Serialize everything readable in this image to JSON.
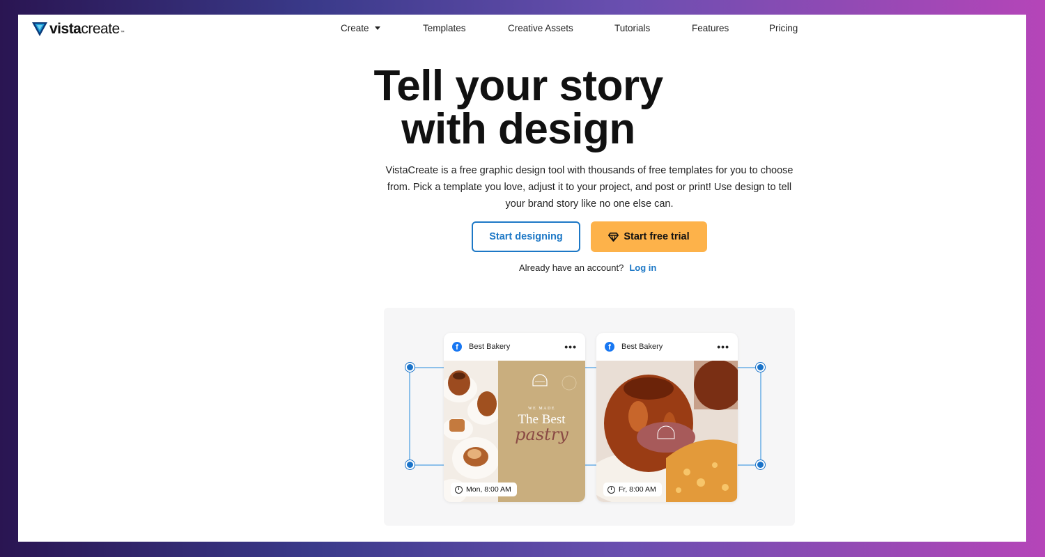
{
  "brand": {
    "logo_bold": "vista",
    "logo_light": "create",
    "tm": "™"
  },
  "nav": {
    "items": [
      {
        "label": "Create",
        "has_caret": true
      },
      {
        "label": "Templates"
      },
      {
        "label": "Creative Assets"
      },
      {
        "label": "Tutorials"
      },
      {
        "label": "Features"
      },
      {
        "label": "Pricing"
      }
    ]
  },
  "hero": {
    "title_line1": "Tell your story",
    "title_line2": "with design",
    "subtitle": "VistaCreate is a free graphic design tool with thousands of free templates for you to choose from. Pick a template you love, adjust it to your project, and post or print! Use design to tell your brand story like no one else can.",
    "primary_button": "Start designing",
    "trial_button": "Start free trial",
    "account_prompt": "Already have an account?",
    "login_link": "Log in"
  },
  "preview": {
    "cards": [
      {
        "page_name": "Best Bakery",
        "time": "Mon, 8:00 AM",
        "overlay_small": "WE MADE",
        "overlay_title": "The Best",
        "overlay_script": "pastry"
      },
      {
        "page_name": "Best Bakery",
        "time": "Fr, 8:00 AM"
      }
    ]
  },
  "colors": {
    "accent_blue": "#1d78c6",
    "trial_orange": "#fdb24a",
    "facebook_blue": "#1877f2",
    "card_tan": "#c9ae7e"
  },
  "icons": [
    "vistacreate-logo-icon",
    "chevron-down-icon",
    "diamond-icon",
    "facebook-icon",
    "more-dots-icon",
    "clock-icon"
  ]
}
